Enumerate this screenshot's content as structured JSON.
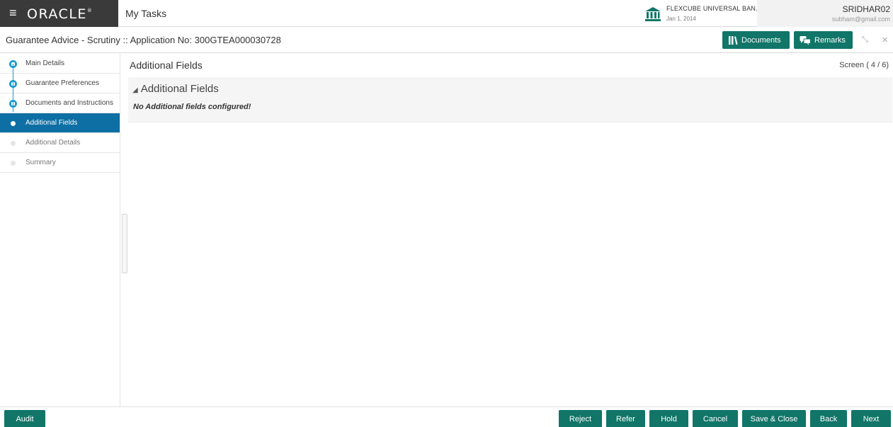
{
  "brand": {
    "logo": "ORACLE",
    "reg": "®"
  },
  "topbar": {
    "menu_icon": "hamburger-icon",
    "app_label": "My Tasks",
    "bank_name": "FLEXCUBE UNIVERSAL BAN...",
    "bank_date": "Jan 1, 2014",
    "user_name": "SRIDHAR02",
    "user_email": "subham@gmail.com"
  },
  "header": {
    "title": "Guarantee Advice - Scrutiny :: Application No: 300GTEA000030728",
    "documents_label": "Documents",
    "remarks_label": "Remarks",
    "minimize_symbol": "⤡",
    "close_symbol": "✕"
  },
  "sidebar": {
    "steps": [
      {
        "label": "Main Details",
        "state": "done"
      },
      {
        "label": "Guarantee Preferences",
        "state": "done"
      },
      {
        "label": "Documents and Instructions",
        "state": "done"
      },
      {
        "label": "Additional Fields",
        "state": "active"
      },
      {
        "label": "Additional Details",
        "state": "todo"
      },
      {
        "label": "Summary",
        "state": "todo"
      }
    ]
  },
  "main": {
    "title": "Additional Fields",
    "screen_indicator": "Screen ( 4 / 6)",
    "section": {
      "heading": "Additional Fields",
      "collapse_symbol": "◢",
      "message": "No Additional fields configured!"
    }
  },
  "footer": {
    "audit": "Audit",
    "reject": "Reject",
    "refer": "Refer",
    "hold": "Hold",
    "cancel": "Cancel",
    "save_close": "Save & Close",
    "back": "Back",
    "next": "Next"
  },
  "colors": {
    "primary": "#117568",
    "active_step": "#0e6fa4",
    "done_step": "#1b9bd1",
    "brand_bg": "#3a3a3a"
  }
}
